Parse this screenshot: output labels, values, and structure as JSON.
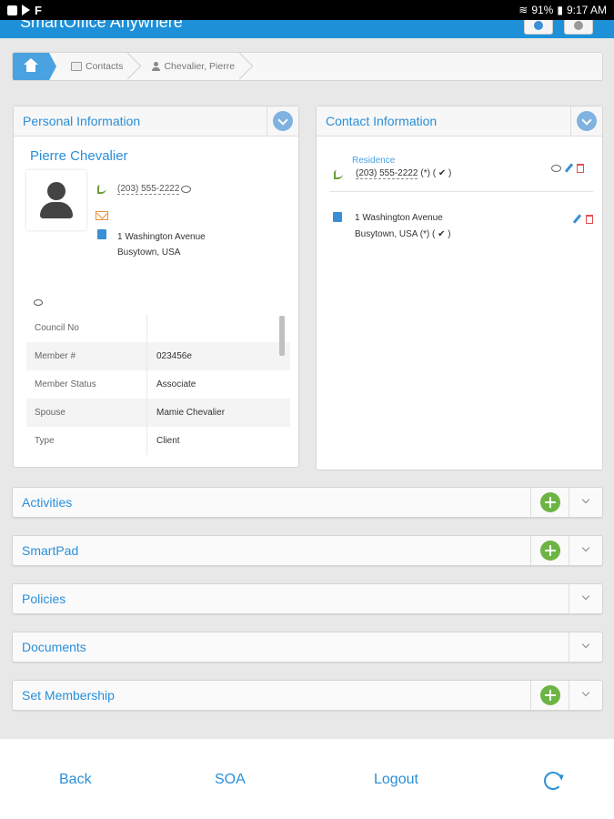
{
  "status_bar": {
    "battery": "91%",
    "time": "9:17 AM"
  },
  "header": {
    "app_title": "SmartOffice Anywhere"
  },
  "breadcrumb": {
    "items": [
      "Contacts",
      "Chevalier, Pierre"
    ]
  },
  "personal_info": {
    "title": "Personal Information",
    "name": "Pierre  Chevalier",
    "phone": "(203) 555-2222",
    "address_line1": "1 Washington Avenue",
    "address_line2": "Busytown, USA",
    "fields": [
      {
        "label": "Council No",
        "value": ""
      },
      {
        "label": "Member #",
        "value": "023456e"
      },
      {
        "label": "Member Status",
        "value": "Associate"
      },
      {
        "label": "Spouse",
        "value": "Mamie Chevalier"
      },
      {
        "label": "Type",
        "value": "Client"
      }
    ]
  },
  "contact_info": {
    "title": "Contact Information",
    "phone_type": "Residence",
    "phone": "(203) 555-2222",
    "phone_suffix": "(*) ( ✔ )",
    "address_line1": "1 Washington Avenue",
    "address_line2": "Busytown, USA",
    "address_suffix": "(*) ( ✔ )"
  },
  "sections": [
    {
      "title": "Activities"
    },
    {
      "title": "SmartPad"
    },
    {
      "title": "Policies"
    },
    {
      "title": "Documents"
    },
    {
      "title": "Set Membership"
    }
  ],
  "bottom_nav": {
    "back": "Back",
    "soa": "SOA",
    "logout": "Logout"
  },
  "icons": [
    "home-icon",
    "contacts-card-icon",
    "user-icon",
    "avatar-icon",
    "phone-icon",
    "mail-icon",
    "address-book-icon",
    "comment-icon",
    "edit-icon",
    "delete-icon",
    "add-icon",
    "chevron-down-icon",
    "refresh-icon"
  ],
  "colors": {
    "accent": "#2a8fd8",
    "header": "#1e90d8",
    "add_green": "#6cb443"
  }
}
